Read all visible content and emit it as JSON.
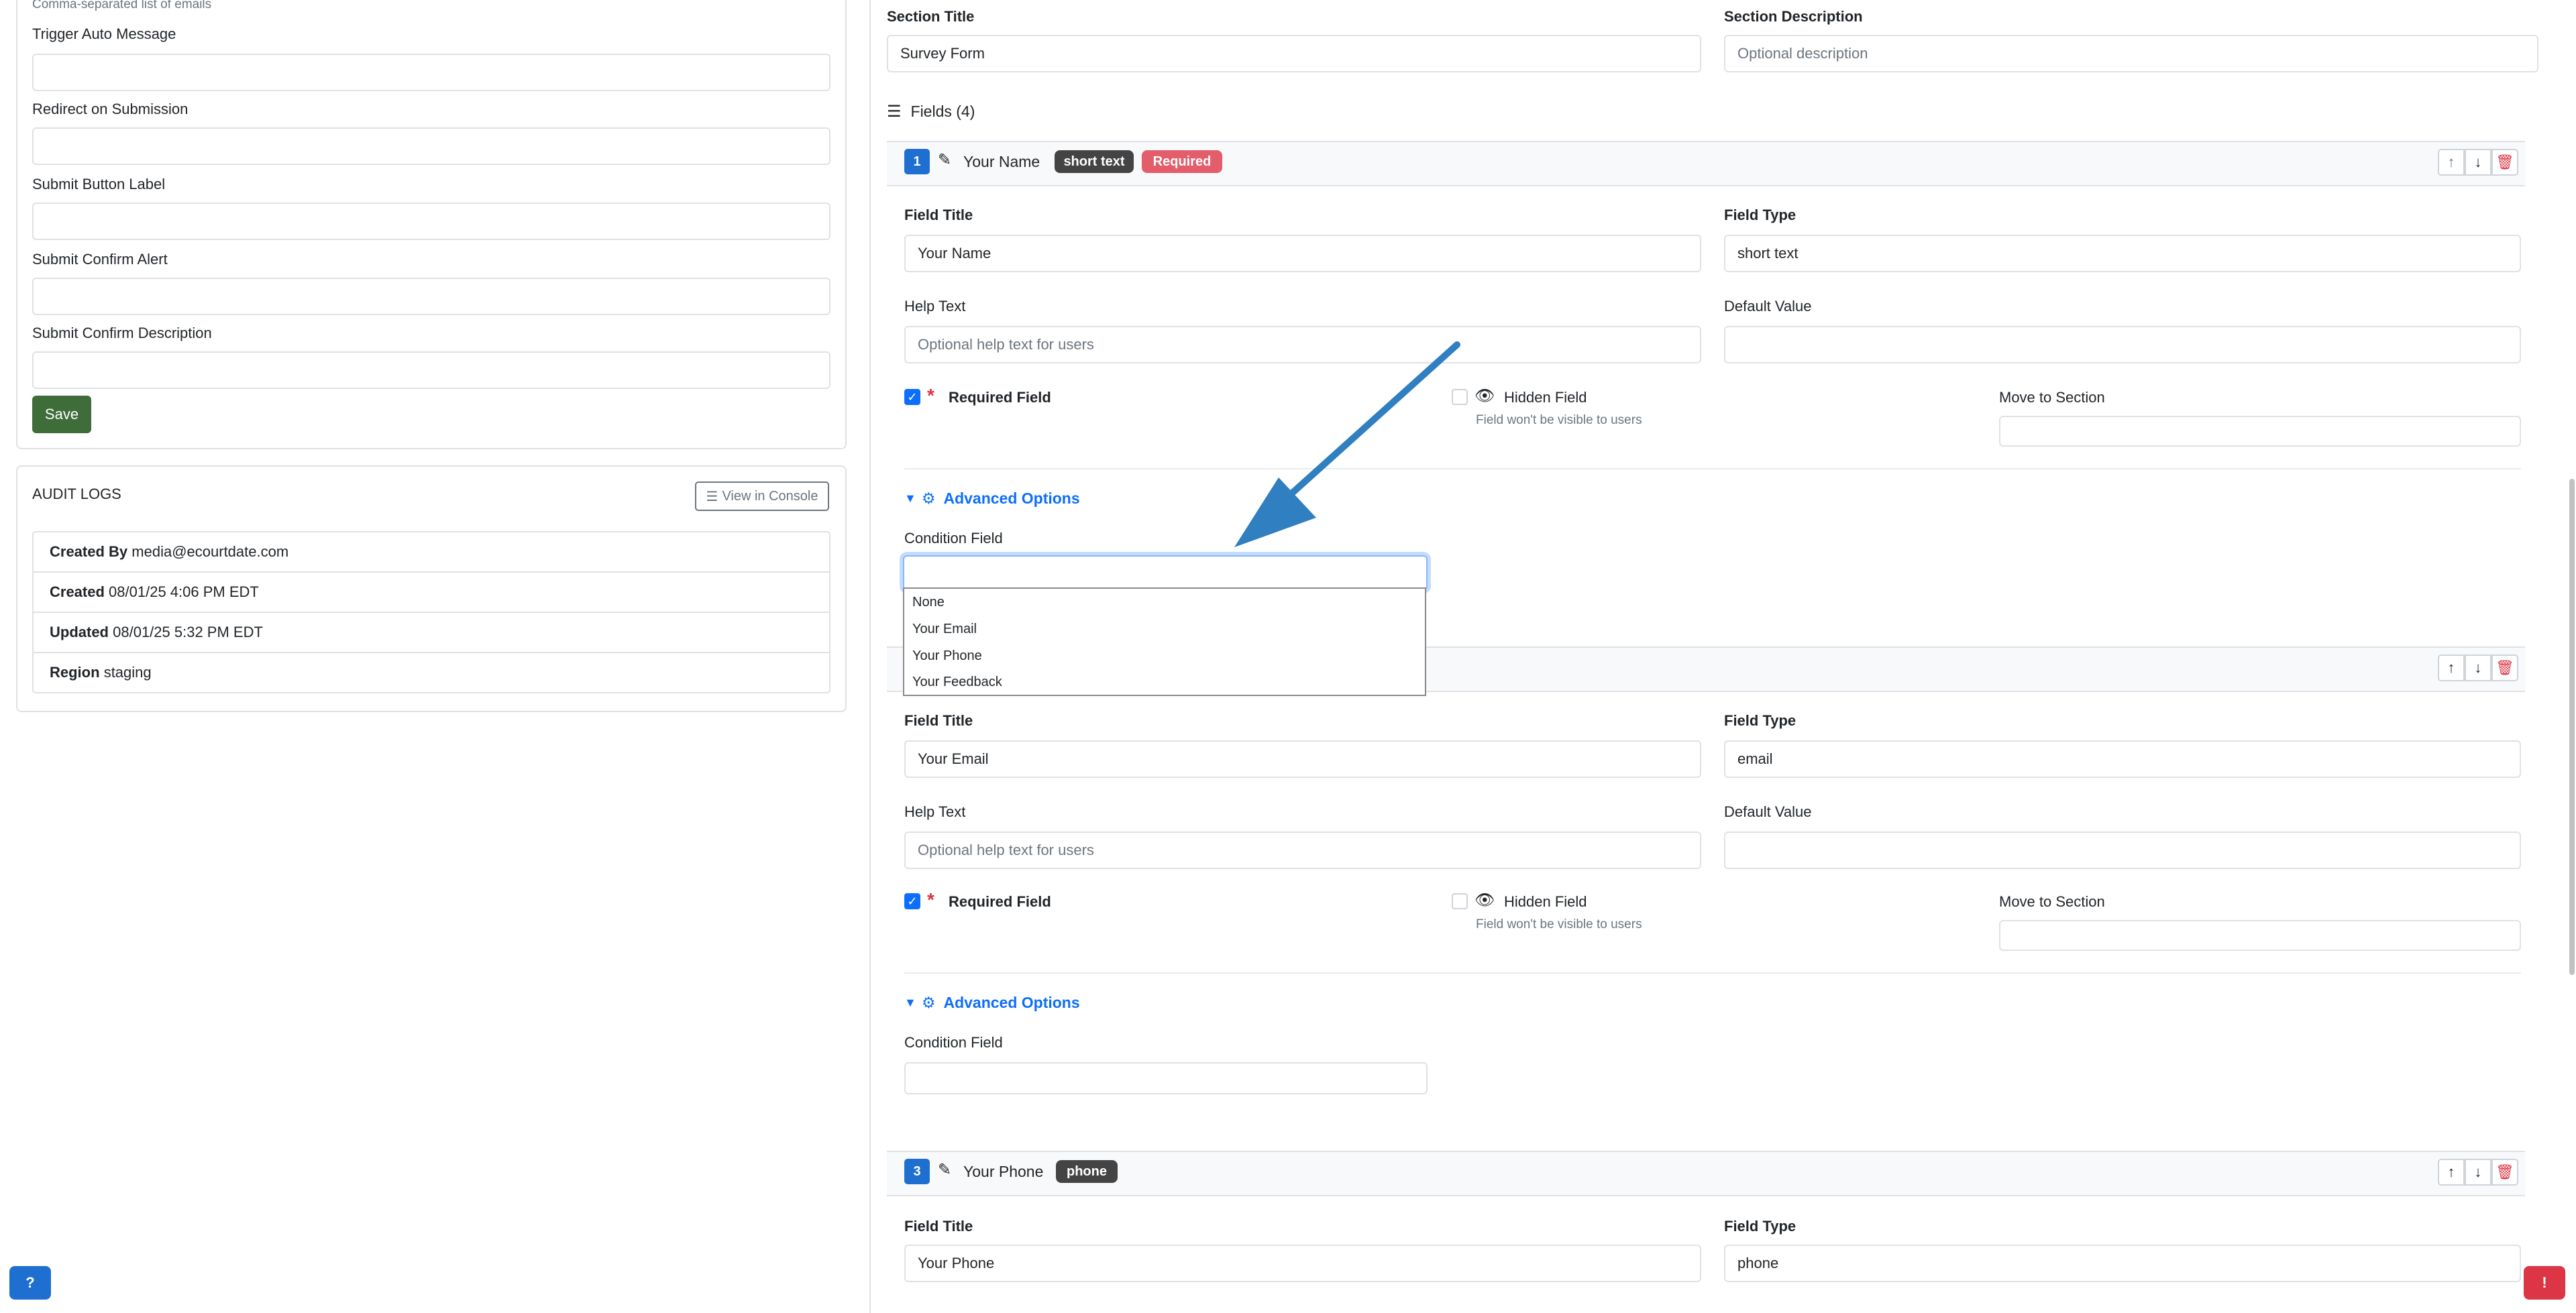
{
  "left_form": {
    "cc_helper": "Comma-separated list of emails",
    "fields": [
      {
        "label": "Trigger Auto Message",
        "value": ""
      },
      {
        "label": "Redirect on Submission",
        "value": ""
      },
      {
        "label": "Submit Button Label",
        "value": ""
      },
      {
        "label": "Submit Confirm Alert",
        "value": ""
      },
      {
        "label": "Submit Confirm Description",
        "value": ""
      }
    ],
    "save_label": "Save"
  },
  "audit": {
    "title": "AUDIT LOGS",
    "view_console_label": "View in Console",
    "rows": [
      {
        "key": "Created By",
        "value": "media@ecourtdate.com"
      },
      {
        "key": "Created",
        "value": "08/01/25 4:06 PM EDT"
      },
      {
        "key": "Updated",
        "value": "08/01/25 5:32 PM EDT"
      },
      {
        "key": "Region",
        "value": "staging"
      }
    ]
  },
  "section": {
    "title_label": "Section Title",
    "title_value": "Survey Form",
    "desc_label": "Section Description",
    "desc_placeholder": "Optional description",
    "fields_header": "Fields (4)"
  },
  "labels": {
    "field_title": "Field Title",
    "field_type": "Field Type",
    "help_text": "Help Text",
    "default_value": "Default Value",
    "help_placeholder": "Optional help text for users",
    "required_field": "Required Field",
    "hidden_field": "Hidden Field",
    "hidden_hint": "Field won't be visible to users",
    "move_to_section": "Move to Section",
    "advanced_options": "Advanced Options",
    "condition_field": "Condition Field"
  },
  "field1": {
    "num": "1",
    "title": "Your Name",
    "badge_type": "short text",
    "badge_required": "Required",
    "type": "short text"
  },
  "field2": {
    "title": "Your Email",
    "type": "email"
  },
  "field3": {
    "num": "3",
    "title": "Your Phone",
    "badge_type": "phone",
    "type": "phone"
  },
  "dropdown": {
    "options": [
      "None",
      "Your Email",
      "Your Phone",
      "Your Feedback"
    ]
  },
  "colors": {
    "primary": "#0d6efd",
    "danger": "#dc3545",
    "success": "#3f6d3a",
    "badge_dark": "#444444",
    "badge_red": "#e35d6a",
    "arrow": "#2f7fc1"
  }
}
